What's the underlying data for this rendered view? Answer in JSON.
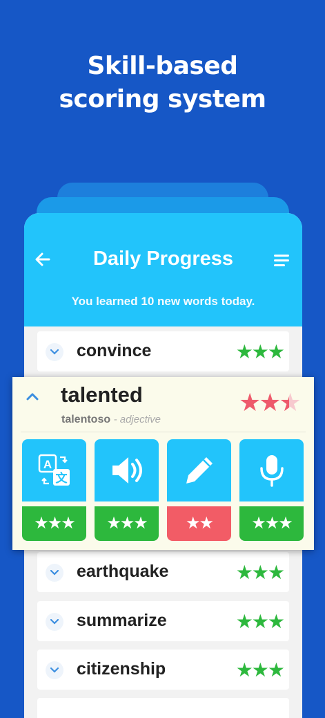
{
  "headline": {
    "line1": "Skill-based",
    "line2": "scoring system"
  },
  "header": {
    "title": "Daily Progress",
    "subtitle": "You learned 10 new words today."
  },
  "words": [
    {
      "word": "convince",
      "stars": "★★★"
    },
    {
      "word": "earthquake",
      "stars": "★★★"
    },
    {
      "word": "summarize",
      "stars": "★★★"
    },
    {
      "word": "citizenship",
      "stars": "★★★"
    }
  ],
  "expanded": {
    "word": "talented",
    "translation": "talentoso",
    "part_of_speech": "- adjective",
    "rating": 2.5,
    "full_stars": "★★",
    "half_star": "★",
    "skills": [
      {
        "icon": "translate-icon",
        "stars": "★★★",
        "status": "good"
      },
      {
        "icon": "speaker-icon",
        "stars": "★★★",
        "status": "good"
      },
      {
        "icon": "pencil-icon",
        "stars": "★★",
        "status": "weak"
      },
      {
        "icon": "microphone-icon",
        "stars": "★★★",
        "status": "good"
      }
    ]
  },
  "colors": {
    "background": "#1657c6",
    "header": "#22c4fb",
    "good": "#2db83d",
    "weak": "#f25c66",
    "rating": "#ee5a6b"
  }
}
